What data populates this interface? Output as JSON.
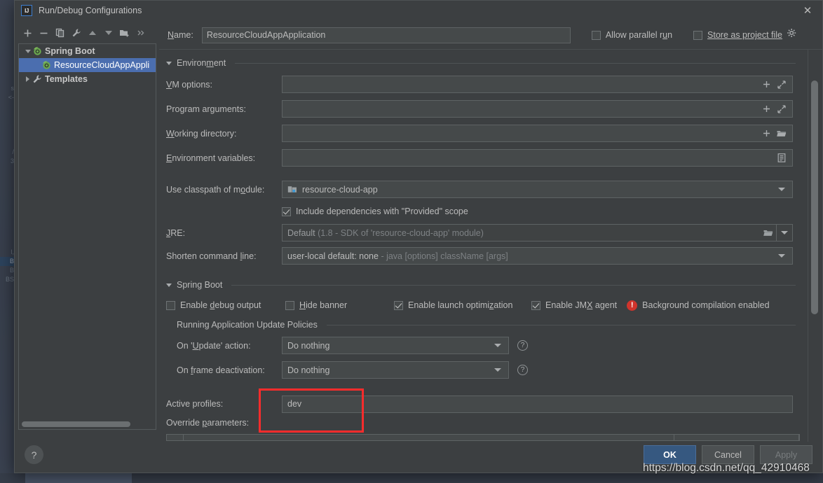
{
  "window": {
    "title": "Run/Debug Configurations",
    "logo_text": "IJ",
    "close_label": "✕"
  },
  "toolbar": {
    "buttons": [
      {
        "name": "add-configuration-button",
        "glyph": "+"
      },
      {
        "name": "remove-configuration-button",
        "glyph": "−"
      },
      {
        "name": "copy-configuration-button",
        "glyph": "copy"
      },
      {
        "name": "edit-templates-button",
        "glyph": "wrench"
      },
      {
        "name": "move-up-button",
        "glyph": "up"
      },
      {
        "name": "move-down-button",
        "glyph": "down"
      },
      {
        "name": "new-folder-button",
        "glyph": "folder-add"
      },
      {
        "name": "more-options-button",
        "glyph": "»"
      }
    ]
  },
  "tree": {
    "items": [
      {
        "label": "Spring Boot",
        "level": 0,
        "expanded": true,
        "selected": false,
        "icon": "spring-boot-icon"
      },
      {
        "label": "ResourceCloudAppAppli",
        "level": 1,
        "expanded": null,
        "selected": true,
        "icon": "spring-boot-icon"
      },
      {
        "label": "Templates",
        "level": 0,
        "expanded": false,
        "selected": false,
        "icon": "wrench-icon"
      }
    ]
  },
  "header": {
    "name_label": "Name:",
    "name_value": "ResourceCloudAppApplication",
    "allow_parallel_run": {
      "label": "Allow parallel run",
      "checked": false
    },
    "store_as_project_file": {
      "label": "Store as project file",
      "checked": false
    }
  },
  "environment": {
    "section_title": "Environment",
    "rows": [
      {
        "label": "VM options:",
        "value": "",
        "type": "expandable"
      },
      {
        "label": "Program arguments:",
        "value": "",
        "type": "expandable"
      },
      {
        "label": "Working directory:",
        "value": "",
        "type": "browse"
      },
      {
        "label": "Environment variables:",
        "value": "",
        "type": "list"
      }
    ],
    "classpath_label": "Use classpath of module:",
    "classpath_value": "resource-cloud-app",
    "include_provided": {
      "label": "Include dependencies with \"Provided\" scope",
      "checked": true
    },
    "jre_label": "JRE:",
    "jre_value": "Default",
    "jre_hint": "(1.8 - SDK of 'resource-cloud-app' module)",
    "shorten_label": "Shorten command line:",
    "shorten_value": "user-local default: none",
    "shorten_hint": "- java [options] className [args]"
  },
  "spring_boot": {
    "section_title": "Spring Boot",
    "checks": [
      {
        "label": "Enable debug output",
        "checked": false
      },
      {
        "label": "Hide banner",
        "checked": false
      },
      {
        "label": "Enable launch optimization",
        "checked": true
      },
      {
        "label": "Enable JMX agent",
        "checked": true
      }
    ],
    "warning_text": "Background compilation enabled",
    "warning_icon": "!",
    "update_policies_title": "Running Application Update Policies",
    "on_update_label": "On 'Update' action:",
    "on_update_value": "Do nothing",
    "on_frame_label": "On frame deactivation:",
    "on_frame_value": "Do nothing",
    "active_profiles_label": "Active profiles:",
    "active_profiles_value": "dev",
    "override_params_label": "Override parameters:"
  },
  "footer": {
    "help_label": "?",
    "ok_label": "OK",
    "cancel_label": "Cancel",
    "apply_label": "Apply"
  },
  "annotation": {
    "highlight_color": "#fb2c2c"
  },
  "watermark": {
    "text": "https://blog.csdn.net/qq_42910468"
  }
}
